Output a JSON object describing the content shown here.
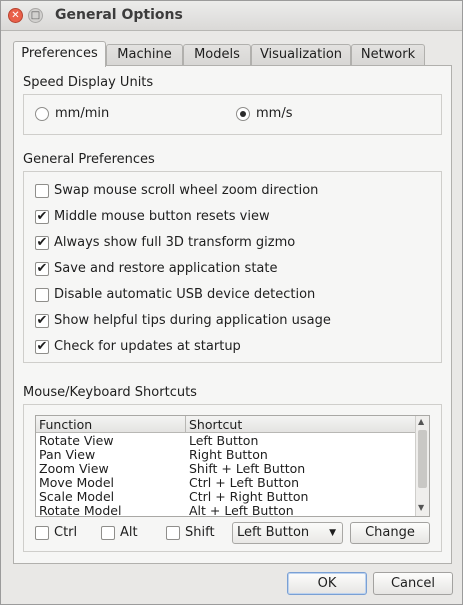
{
  "window": {
    "title": "General Options"
  },
  "tabs": [
    {
      "label": "Preferences",
      "active": true
    },
    {
      "label": "Machine",
      "active": false
    },
    {
      "label": "Models",
      "active": false
    },
    {
      "label": "Visualization",
      "active": false
    },
    {
      "label": "Network",
      "active": false
    }
  ],
  "speed_units": {
    "title": "Speed Display Units",
    "options": [
      {
        "label": "mm/min",
        "selected": false
      },
      {
        "label": "mm/s",
        "selected": true
      }
    ]
  },
  "general": {
    "title": "General Preferences",
    "items": [
      {
        "label": "Swap mouse scroll wheel zoom direction",
        "checked": false
      },
      {
        "label": "Middle mouse button resets view",
        "checked": true
      },
      {
        "label": "Always show full 3D transform gizmo",
        "checked": true
      },
      {
        "label": "Save and restore application state",
        "checked": true
      },
      {
        "label": "Disable automatic USB device detection",
        "checked": false
      },
      {
        "label": "Show helpful tips during application usage",
        "checked": true
      },
      {
        "label": "Check for updates at startup",
        "checked": true
      }
    ]
  },
  "shortcuts": {
    "title": "Mouse/Keyboard Shortcuts",
    "columns": [
      "Function",
      "Shortcut"
    ],
    "rows": [
      [
        "Rotate View",
        "Left Button"
      ],
      [
        "Pan View",
        "Right Button"
      ],
      [
        "Zoom View",
        "Shift + Left Button"
      ],
      [
        "Move Model",
        "Ctrl + Left Button"
      ],
      [
        "Scale Model",
        "Ctrl + Right Button"
      ],
      [
        "Rotate Model",
        "Alt + Left Button"
      ]
    ],
    "modifiers": [
      {
        "label": "Ctrl",
        "checked": false
      },
      {
        "label": "Alt",
        "checked": false
      },
      {
        "label": "Shift",
        "checked": false
      }
    ],
    "button_select": "Left Button",
    "change_label": "Change"
  },
  "footer": {
    "ok_label": "OK",
    "cancel_label": "Cancel"
  },
  "glyphs": {
    "check": "✔",
    "close": "✕",
    "maximize": "□",
    "dropdown": "▼",
    "up": "▲",
    "down": "▼"
  }
}
